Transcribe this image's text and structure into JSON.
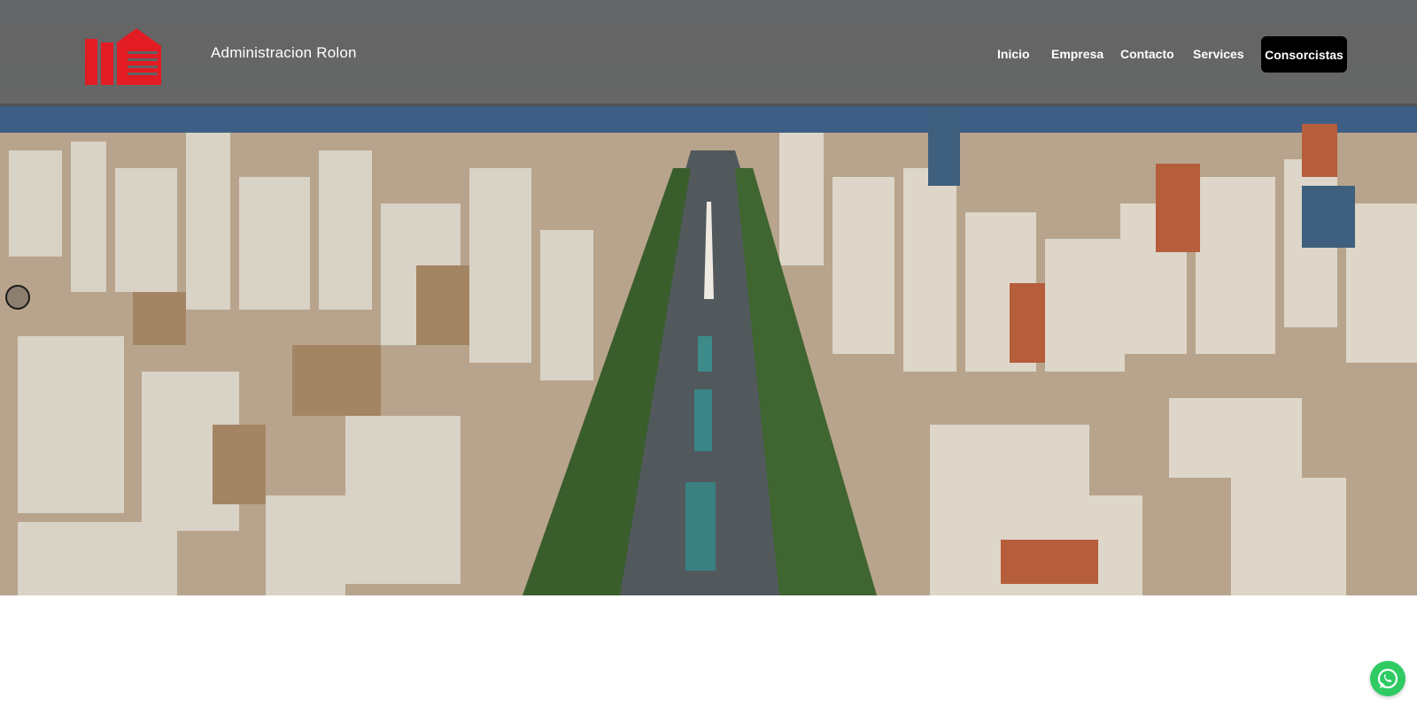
{
  "brand": {
    "name": "Administracion Rolon",
    "logo_icon": "building-logo-icon",
    "logo_color": "#e31b23"
  },
  "nav": {
    "items": [
      {
        "label": "Inicio"
      },
      {
        "label": "Empresa"
      },
      {
        "label": "Contacto"
      },
      {
        "label": "Services"
      }
    ],
    "cta": {
      "label": "Consorcistas"
    }
  },
  "hero": {
    "image_icon": "city-aerial-photo",
    "carousel_icon": "carousel-indicator-icon"
  },
  "chat": {
    "icon": "whatsapp-icon",
    "color": "#2ecb63"
  }
}
